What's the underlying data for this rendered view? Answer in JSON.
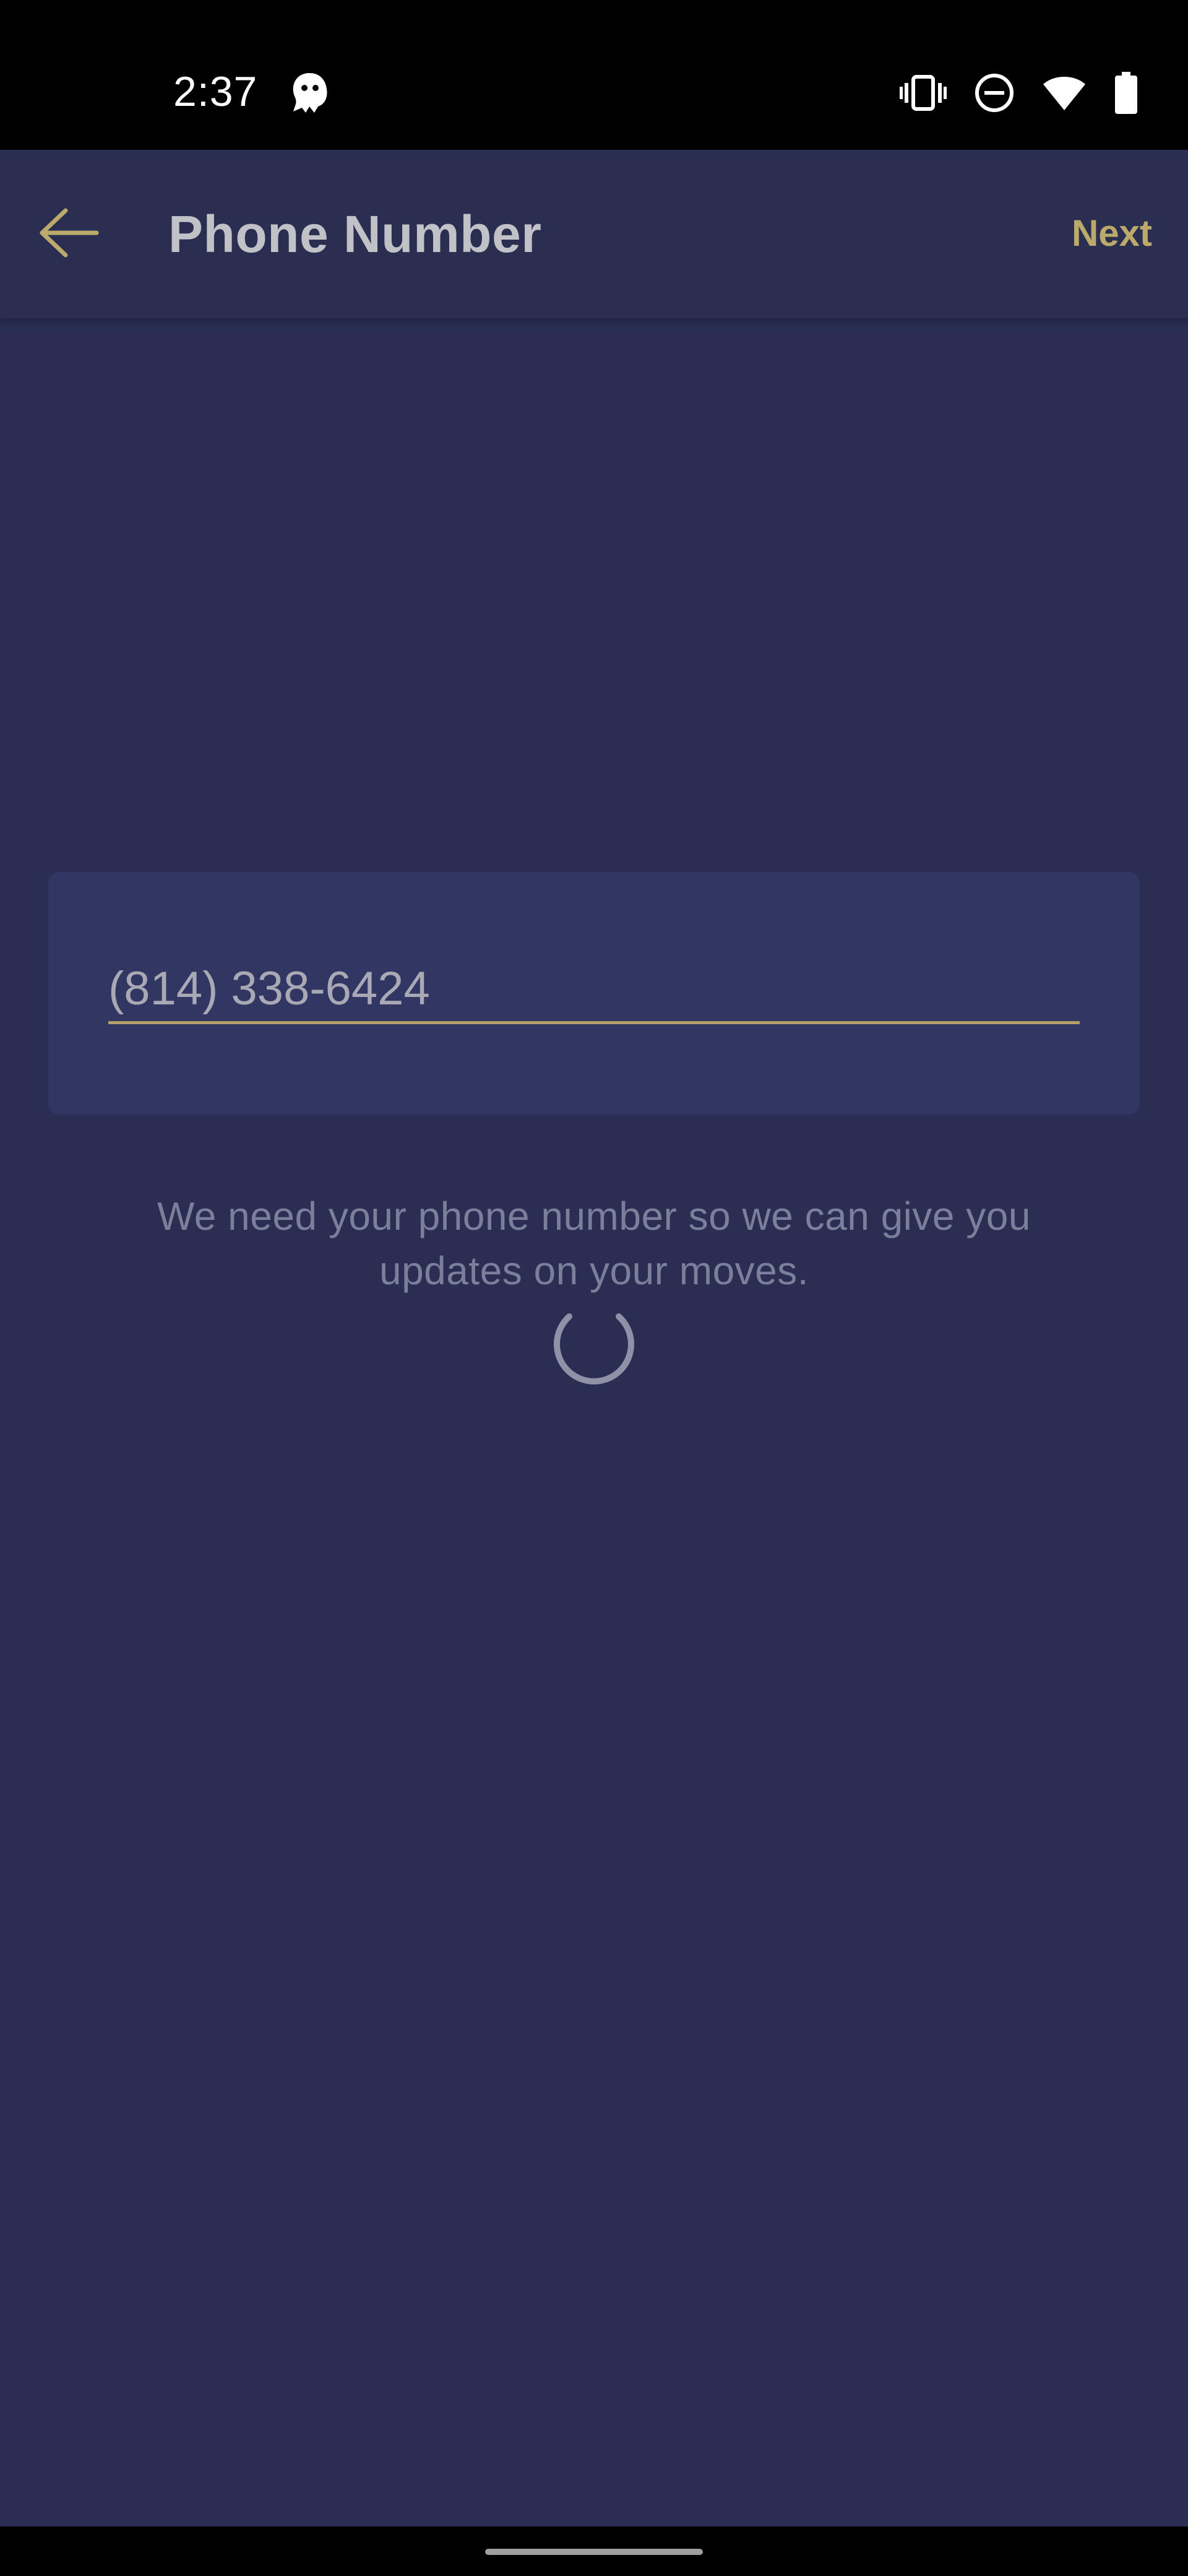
{
  "status_bar": {
    "time": "2:37",
    "icons": [
      "notification-app-icon",
      "vibrate-icon",
      "do-not-disturb-icon",
      "wifi-icon",
      "battery-icon"
    ]
  },
  "app_bar": {
    "title": "Phone Number",
    "next_label": "Next",
    "back_icon": "arrow-left-icon"
  },
  "form": {
    "phone_value": "(814) 338-6424"
  },
  "helper_text": "We need your phone number so we can give you updates on your moves.",
  "colors": {
    "background": "#292e52",
    "card": "#323663",
    "accent": "#bca96c",
    "title_text": "#c1c1c8",
    "helper_text": "#7c7f9a"
  },
  "loading": true
}
